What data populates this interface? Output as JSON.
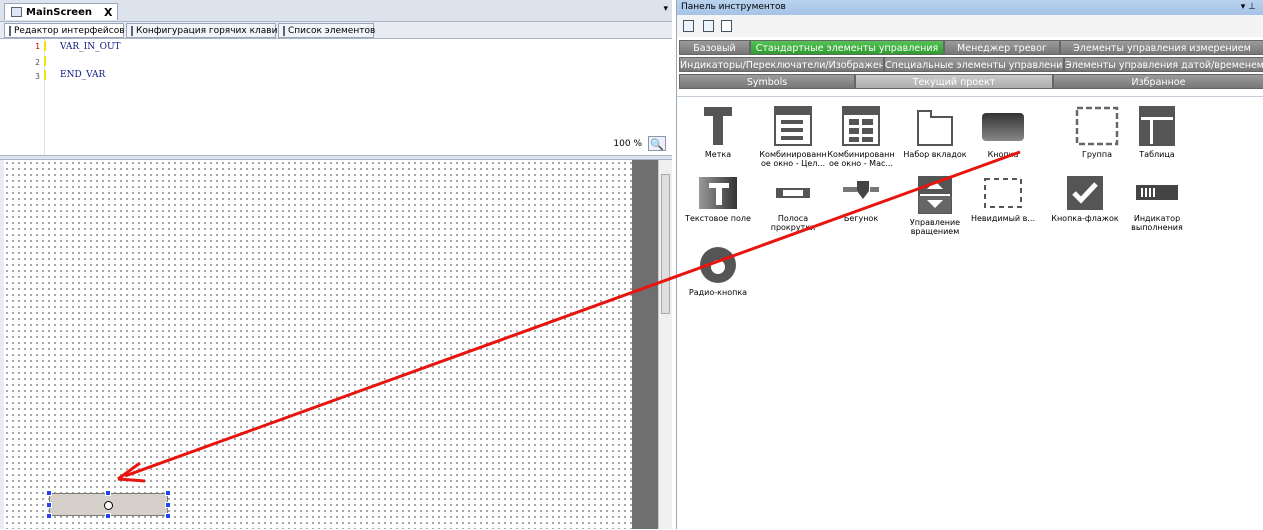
{
  "left": {
    "doc_tab": {
      "title": "MainScreen",
      "close": "X"
    },
    "sub_tabs": [
      "Редактор интерфейсов",
      "Конфигурация горячих клавиш",
      "Список элементов"
    ],
    "code": {
      "line_numbers": [
        "1",
        "2",
        "3"
      ],
      "lines": [
        "VAR_IN_OUT",
        "",
        "END_VAR"
      ]
    },
    "zoom": "100 %"
  },
  "panel": {
    "title": "Панель инструментов",
    "controls": "▾ ⊥",
    "categories_row1": [
      "Базовый",
      "Стандартные элементы управления",
      "Менеджер тревог",
      "Элементы управления измерением"
    ],
    "categories_row2": [
      "Индикаторы/Переключатели/Изображения",
      "Специальные элементы управления",
      "Элементы управления датой/временем"
    ],
    "categories_row3": [
      "Symbols",
      "Текущий проект",
      "Избранное"
    ],
    "active_category": "Стандартные элементы управления",
    "items": [
      {
        "icon": "label-icon",
        "label": "Метка"
      },
      {
        "icon": "combobox-int-icon",
        "label": "Комбинированн ое окно - Цел..."
      },
      {
        "icon": "combobox-array-icon",
        "label": "Комбинированн ое окно - Мас..."
      },
      {
        "icon": "tab-control-icon",
        "label": "Набор вкладок"
      },
      {
        "icon": "button-icon",
        "label": "Кнопка"
      },
      {
        "icon": "group-box-icon",
        "label": "Группа"
      },
      {
        "icon": "table-icon",
        "label": "Таблица"
      },
      {
        "icon": "text-field-icon",
        "label": "Текстовое поле"
      },
      {
        "icon": "scrollbar-icon",
        "label": "Полоса прокрутки"
      },
      {
        "icon": "slider-icon",
        "label": "Бегунок"
      },
      {
        "icon": "spin-control-icon",
        "label": "Управление вращением"
      },
      {
        "icon": "invisible-input-icon",
        "label": "Невидимый в..."
      },
      {
        "icon": "checkbox-icon",
        "label": "Кнопка-флажок"
      },
      {
        "icon": "progress-bar-icon",
        "label": "Индикатор выполнения"
      },
      {
        "icon": "radio-button-icon",
        "label": "Радио-кнопка"
      }
    ]
  },
  "colors": {
    "active_category": "#3fae3f",
    "inactive_category": "#8a8a8a",
    "arrow": "#e8140f",
    "selection_handles": "#2244ee"
  }
}
